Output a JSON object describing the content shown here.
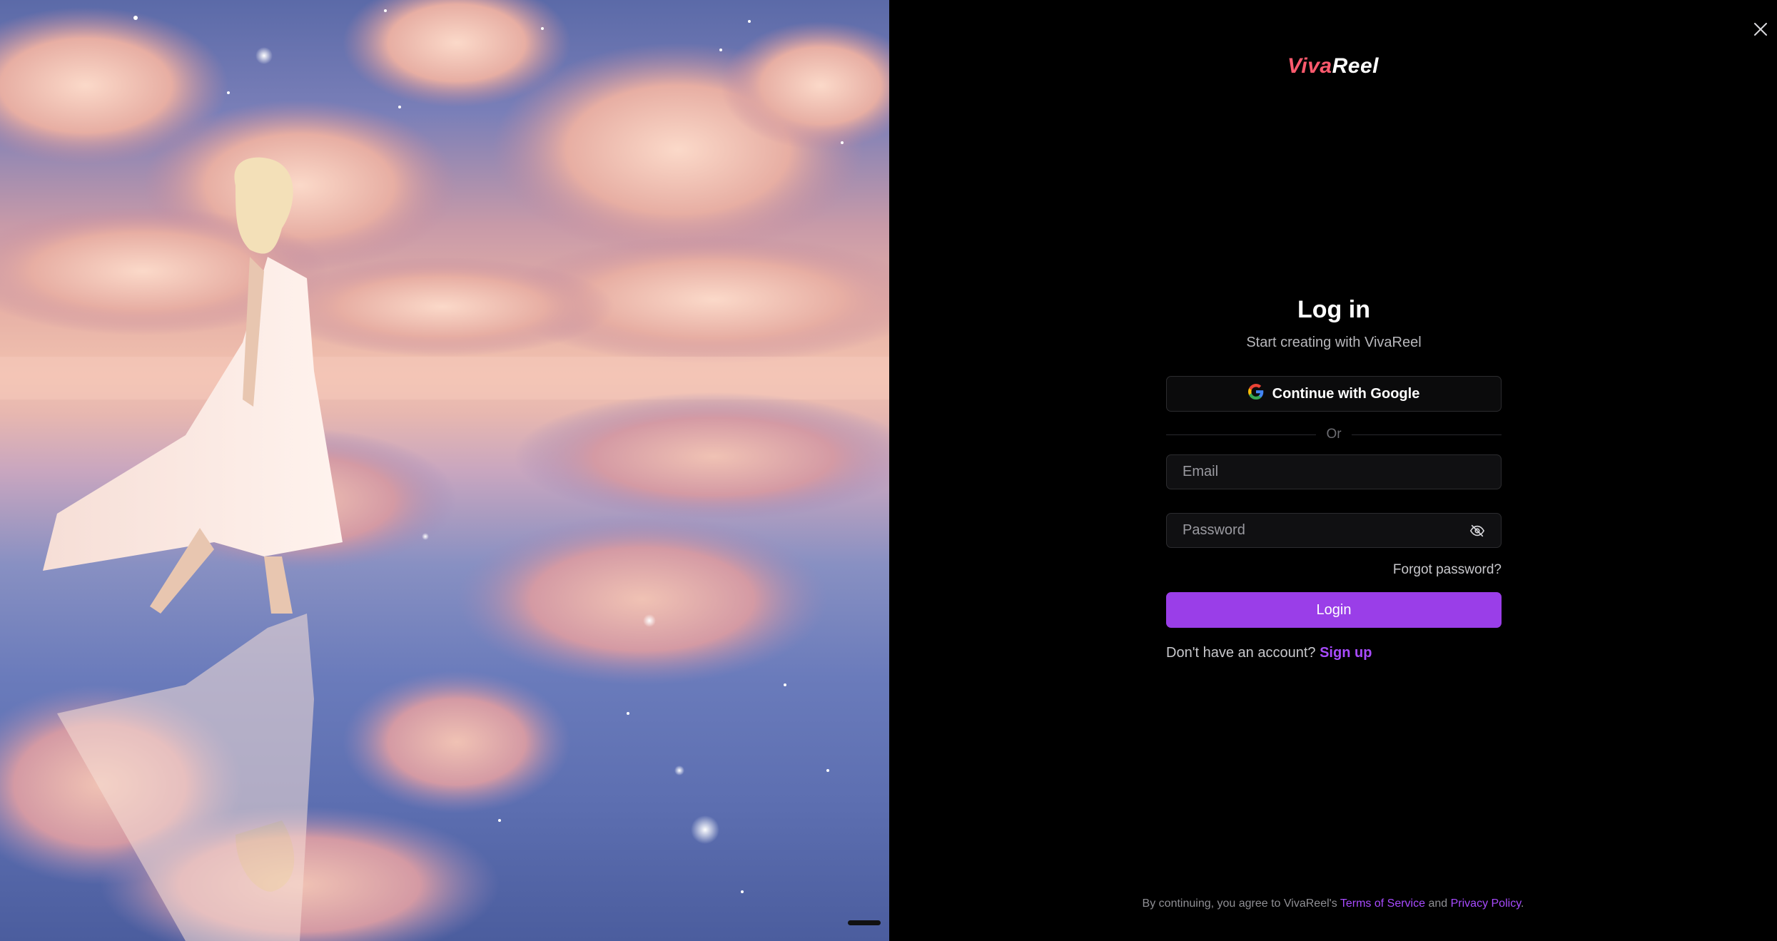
{
  "window": {
    "close_label": "×"
  },
  "hero": {
    "image_alt": "Woman in white dress walking on reflective salt flat under pink clouds and starry sky"
  },
  "brand": {
    "logo_part1": "Viva",
    "logo_part2": "Reel"
  },
  "login": {
    "title": "Log in",
    "subtitle": "Start creating with VivaReel",
    "google_label": "Continue with Google",
    "divider_label": "Or",
    "email_placeholder": "Email",
    "password_placeholder": "Password",
    "forgot_label": "Forgot password?",
    "submit_label": "Login",
    "signup_prompt": "Don't have an account?",
    "signup_label": "Sign up"
  },
  "footer": {
    "prefix": "By continuing, you agree to VivaReel's",
    "terms_label": "Terms of Service",
    "and_label": "and",
    "privacy_label": "Privacy Policy",
    "suffix": "."
  },
  "colors": {
    "accent": "#9a3ee8",
    "link": "#a84bff",
    "background": "#000000",
    "logo_viva": "#ff5a6e"
  },
  "icons": [
    "close-icon",
    "google-icon",
    "eye-off-icon"
  ]
}
